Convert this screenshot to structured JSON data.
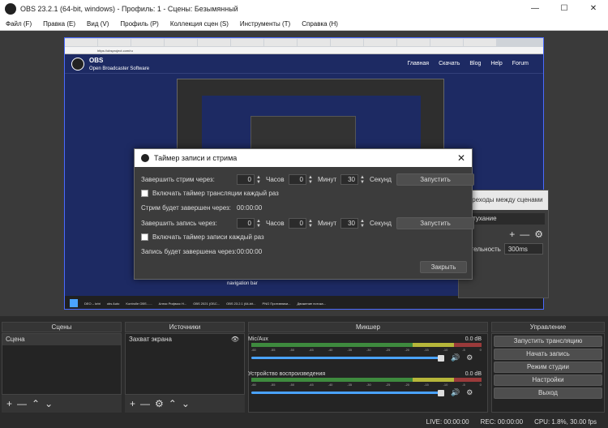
{
  "window": {
    "title": "OBS 23.2.1 (64-bit, windows) - Профиль: 1 - Сцены: Безымянный",
    "controls": [
      "—",
      "☐",
      "✕"
    ]
  },
  "menu": [
    "Файл (F)",
    "Правка (E)",
    "Вид (V)",
    "Профиль (P)",
    "Коллекция сцен (S)",
    "Инструменты (T)",
    "Справка (H)"
  ],
  "preview": {
    "url": "https://obsproject.com/ru",
    "site_title": "OBS",
    "site_subtitle": "Open Broadcaster Software",
    "nav": [
      "Главная",
      "Скачать",
      "Blog",
      "Help",
      "Forum"
    ],
    "navigation_text": "navigation bar",
    "taskbar_items": [
      "DEO – krbt",
      "obs Auto",
      "Kontrolle OBS - ...",
      "Алекс Рифмос Н...",
      "OBS 2021 (ОБС...",
      "OBS 23.2.1 (64-bit...",
      "PNG Противники...",
      "Движение потока..."
    ]
  },
  "transitions": {
    "header": "Переходы между сценами",
    "selected": "Затухание",
    "duration_label": "Длительность",
    "duration_value": "300ms"
  },
  "dialog": {
    "title": "Таймер записи и стрима",
    "stream_label": "Завершить стрим через:",
    "stream_hours": "0",
    "stream_minutes": "0",
    "stream_seconds": "30",
    "hours_label": "Часов",
    "minutes_label": "Минут",
    "seconds_label": "Секунд",
    "start_button": "Запустить",
    "stream_checkbox": "Включать таймер трансляции каждый раз",
    "stream_ends_label": "Стрим будет завершен через:",
    "stream_ends_value": "00:00:00",
    "record_label": "Завершить запись через:",
    "record_hours": "0",
    "record_minutes": "0",
    "record_seconds": "30",
    "record_checkbox": "Включать таймер записи каждый раз",
    "record_ends_label": "Запись будет завершена через:",
    "record_ends_value": "00:00:00",
    "close_button": "Закрыть"
  },
  "panels": {
    "scenes_title": "Сцены",
    "scenes": [
      "Сцена"
    ],
    "sources_title": "Источники",
    "sources": [
      "Захват экрана"
    ],
    "mixer_title": "Микшер",
    "controls_title": "Управление"
  },
  "mixer": {
    "channels": [
      {
        "name": "Mic/Aux",
        "db": "0.0 dB",
        "level": 0.0
      },
      {
        "name": "Устройство воспроизведения",
        "db": "0.0 dB",
        "level": 0.0
      }
    ],
    "ticks": [
      "-60",
      "-55",
      "-50",
      "-45",
      "-40",
      "-35",
      "-30",
      "-25",
      "-20",
      "-15",
      "-10",
      "-5",
      "0"
    ]
  },
  "controls": [
    "Запустить трансляцию",
    "Начать запись",
    "Режим студии",
    "Настройки",
    "Выход"
  ],
  "status": {
    "live": "LIVE: 00:00:00",
    "rec": "REC: 00:00:00",
    "cpu": "CPU: 1.8%, 30.00 fps"
  }
}
